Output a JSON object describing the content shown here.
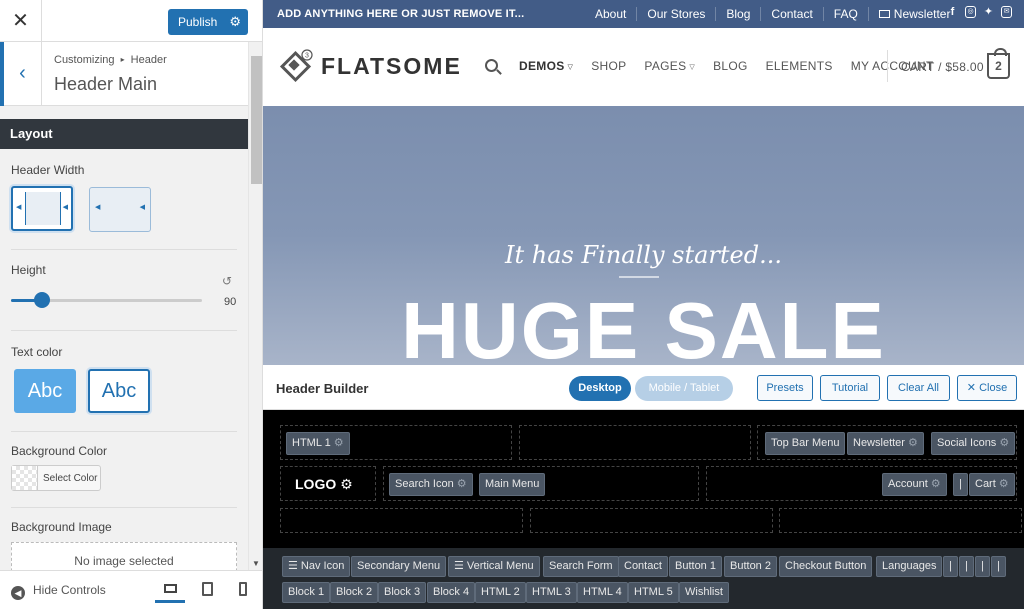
{
  "customizer": {
    "close_icon": "close-icon",
    "publish_label": "Publish",
    "breadcrumb_root": "Customizing",
    "breadcrumb_sep": "▸",
    "breadcrumb_parent": "Header",
    "section_title": "Header Main",
    "layout_heading": "Layout",
    "header_width_label": "Header Width",
    "height_label": "Height",
    "height_value": "90",
    "height_fraction": 0.16,
    "text_color_label": "Text color",
    "text_color_option": "Abc",
    "background_color_label": "Background Color",
    "select_color_label": "Select Color",
    "background_image_label": "Background Image",
    "no_image_label": "No image selected",
    "hide_controls_label": "Hide Controls",
    "accent_color": "#2271b1"
  },
  "preview": {
    "topbar_text": "ADD ANYTHING HERE OR JUST REMOVE IT...",
    "topbar_menu": [
      "About",
      "Our Stores",
      "Blog",
      "Contact",
      "FAQ"
    ],
    "newsletter_label": "Newsletter",
    "social_icons": [
      "facebook-icon",
      "instagram-icon",
      "twitter-icon",
      "email-icon"
    ],
    "logo_text": "FLATSOME",
    "logo_badge": "3",
    "nav": [
      {
        "label": "DEMOS",
        "caret": true
      },
      {
        "label": "SHOP",
        "caret": false
      },
      {
        "label": "PAGES",
        "caret": true
      },
      {
        "label": "BLOG",
        "caret": false
      },
      {
        "label": "ELEMENTS",
        "caret": false
      },
      {
        "label": "MY ACCOUNT",
        "caret": false
      }
    ],
    "cart_label": "CART / $58.00",
    "cart_count": "2",
    "hero_subtitle": "It has Finally started...",
    "hero_title": "HUGE SALE",
    "topbar_color": "#425c87"
  },
  "builder": {
    "title": "Header Builder",
    "mode_desktop": "Desktop",
    "mode_mobile": "Mobile / Tablet",
    "buttons": {
      "presets": "Presets",
      "tutorial": "Tutorial",
      "clear_all": "Clear All",
      "close": "Close"
    },
    "top_left_chips": [
      "HTML 1"
    ],
    "top_right_chips": [
      "Top Bar Menu",
      "Newsletter",
      "Social Icons"
    ],
    "logo_label": "LOGO",
    "main_left_chips": [
      "Search Icon",
      "Main Menu"
    ],
    "main_right_chips": [
      "Account",
      "|",
      "Cart"
    ],
    "tray_row1": [
      "☰ Nav Icon",
      "Secondary Menu",
      "☰ Vertical Menu",
      "Search Form",
      "Contact",
      "Button 1",
      "Button 2",
      "Checkout Button",
      "Languages",
      "|",
      "|",
      "|",
      "|"
    ],
    "tray_row2": [
      "Block 1",
      "Block 2",
      "Block 3",
      "Block 4",
      "HTML 2",
      "HTML 3",
      "HTML 4",
      "HTML 5",
      "Wishlist"
    ]
  }
}
